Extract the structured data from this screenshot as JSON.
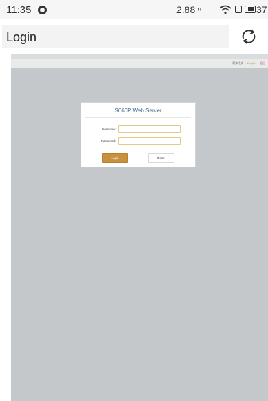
{
  "status_bar": {
    "time": "11:35",
    "net_speed": "2.88 ⁿ",
    "battery_level": "37",
    "icons": [
      "vpn-icon",
      "wifi-icon",
      "sim-icon",
      "battery-icon"
    ]
  },
  "app_header": {
    "title": "Login",
    "refresh_icon": "refresh-icon"
  },
  "webpage": {
    "language_bar": {
      "lang_zh": "简体中文",
      "separator": "|",
      "lang_en": "English",
      "logout": "退出"
    },
    "login_form": {
      "title": "S660P Web Server",
      "username_label": "Username:",
      "username_value": "",
      "password_label": "Password:",
      "password_value": "",
      "login_button": "Login",
      "reset_button": "Reset"
    }
  },
  "colors": {
    "background_gray": "#c4c8ca",
    "title_blue": "#3f6a92",
    "login_button": "#c8913d",
    "input_border": "#e4c98a"
  }
}
